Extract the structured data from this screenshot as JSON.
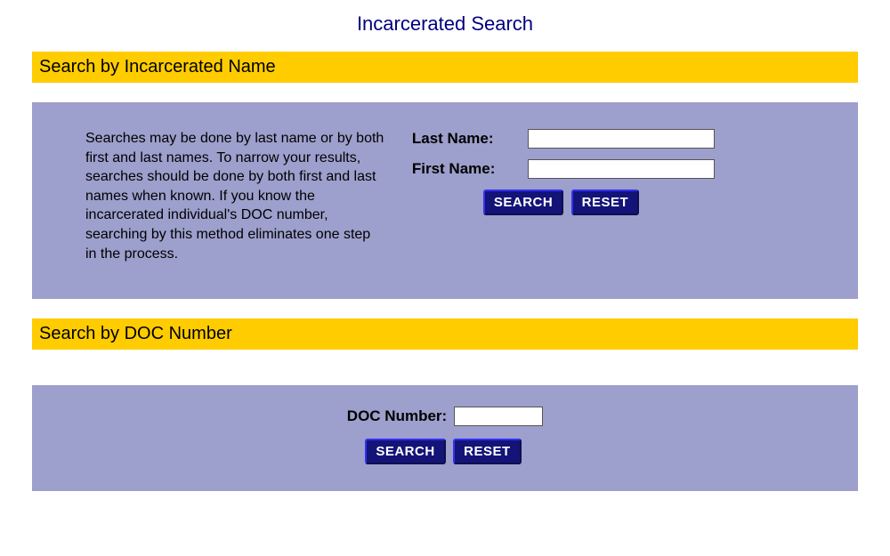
{
  "page": {
    "title": "Incarcerated Search"
  },
  "searchByName": {
    "header": "Search by Incarcerated Name",
    "instructions": "Searches may be done by last name or by both first and last names.  To narrow your results, searches should be done by both first and last names when known. If you know the incarcerated individual's DOC number, searching by this method eliminates one step in the process.",
    "lastNameLabel": "Last Name:",
    "firstNameLabel": "First Name:",
    "lastNameValue": "",
    "firstNameValue": "",
    "searchButton": "SEARCH",
    "resetButton": "RESET"
  },
  "searchByDoc": {
    "header": "Search by DOC Number",
    "docLabel": "DOC Number:",
    "docValue": "",
    "searchButton": "SEARCH",
    "resetButton": "RESET"
  }
}
